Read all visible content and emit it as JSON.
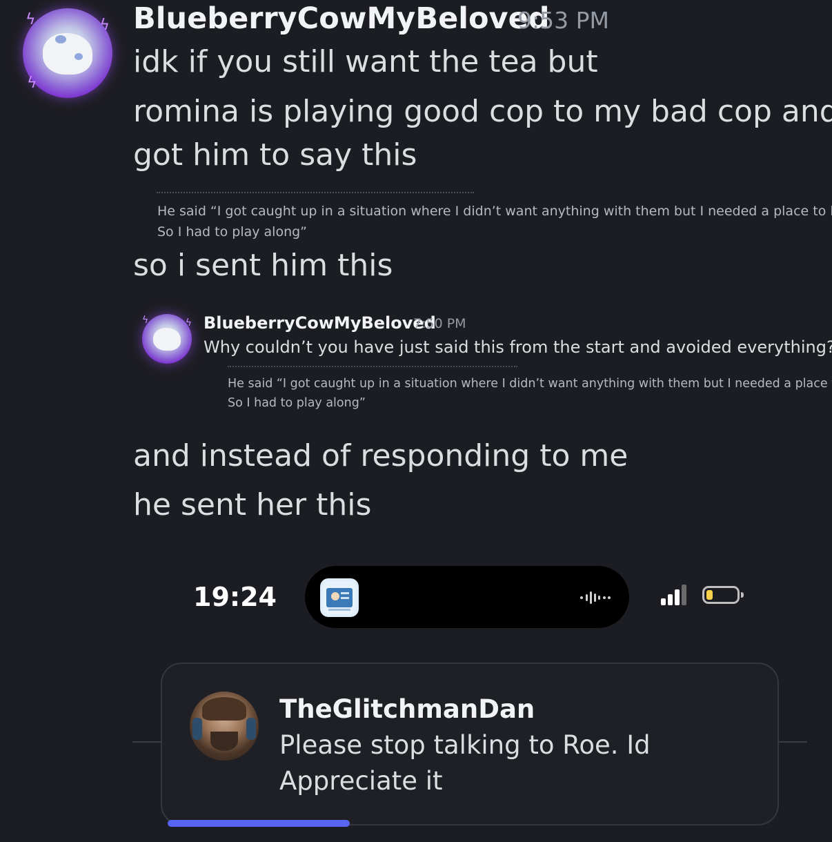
{
  "message": {
    "author": "BlueberryCowMyBeloved",
    "timestamp": "9:53 PM",
    "lines": [
      "idk if you still want the tea but",
      "romina is playing good cop to my bad cop and",
      "got him to say this",
      "so i sent him this",
      "and instead of responding to me",
      "he sent her this"
    ],
    "quote_1": [
      "He said “I got caught up in a situation where I didn’t want anything with them but I needed a place to live",
      "So I had to play along”"
    ],
    "embedded": {
      "author": "BlueberryCowMyBeloved",
      "timestamp": "7:50 PM",
      "text": "Why couldn’t you have just said this from the start and avoided everything?",
      "quote": [
        "He said “I got caught up in a situation where I didn’t want anything with them but I needed a place to live",
        "So I had to play along”"
      ]
    }
  },
  "phone": {
    "clock": "19:24",
    "battery_level_percent": 20,
    "signal_bars": 3,
    "notification": {
      "sender": "TheGlitchmanDan",
      "lines": [
        "Please stop talking to Roe. Id",
        "Appreciate it"
      ]
    }
  },
  "colors": {
    "background": "#1c1d22",
    "accent_progress": "#5865f2",
    "battery": "#f7d14a"
  },
  "icons": [
    "blueberry-cow-avatar",
    "app-icon",
    "audio-wave-icon",
    "signal-icon",
    "battery-icon",
    "glitchman-avatar"
  ]
}
